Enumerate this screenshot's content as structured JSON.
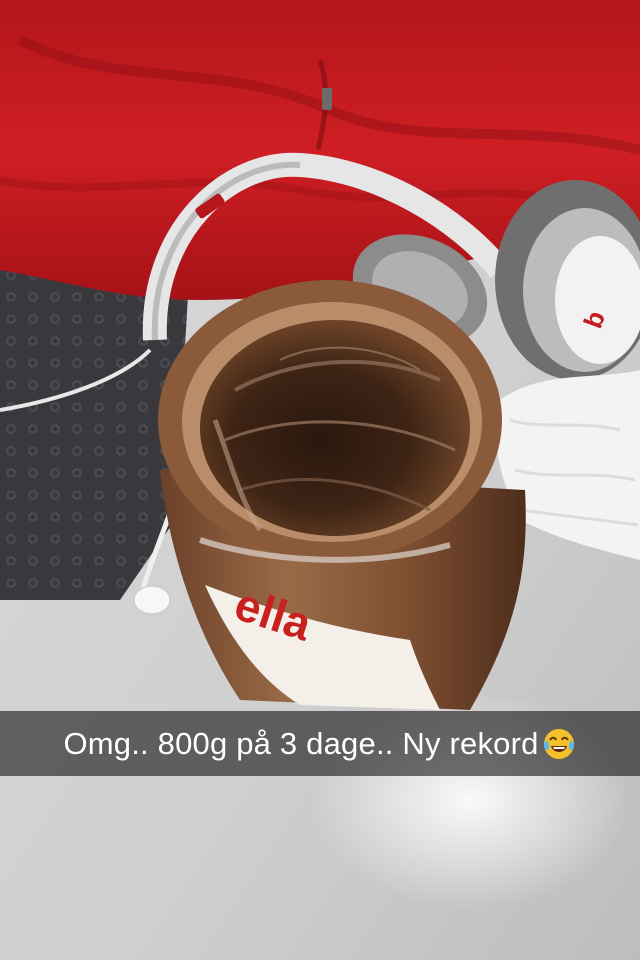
{
  "snap": {
    "caption": "Omg.. 800g på 3 dage.. Ny rekord",
    "caption_emoji": "face-with-tears-of-joy-icon"
  },
  "photo": {
    "subjects": [
      "nutella-jar",
      "headphones",
      "red-sweater",
      "white-earbuds",
      "fluffy-white-fabric"
    ],
    "jar_label_fragment": "ella"
  },
  "colors": {
    "sweater_red": "#c41a1e",
    "chocolate": "#5a3520",
    "table_grey": "#d4d4d4",
    "mat_dark": "#3c3c40",
    "caption_bg": "rgba(0,0,0,0.55)",
    "caption_text": "#ffffff"
  }
}
